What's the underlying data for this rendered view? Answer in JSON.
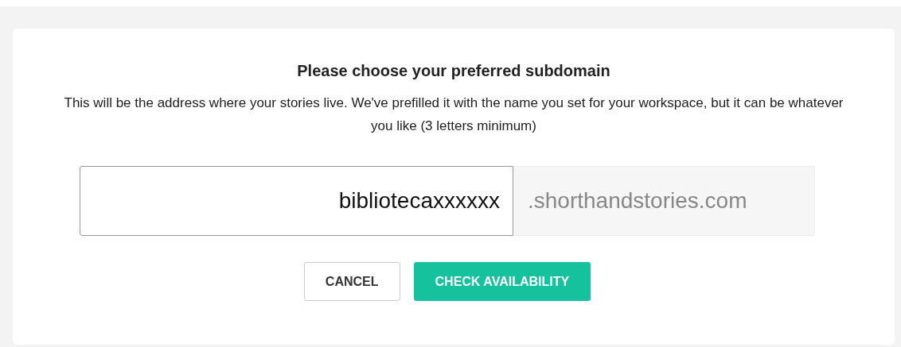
{
  "dialog": {
    "title": "Please choose your preferred subdomain",
    "description": "This will be the address where your stories live. We've prefilled it with the name you set for your workspace, but it can be whatever you like (3 letters minimum)",
    "subdomain_field": {
      "value": "bibliotecaxxxxxx",
      "suffix": ".shorthandstories.com"
    },
    "buttons": [
      {
        "label": "CANCEL",
        "kind": "secondary"
      },
      {
        "label": "CHECK AVAILABILITY",
        "kind": "primary"
      }
    ]
  }
}
